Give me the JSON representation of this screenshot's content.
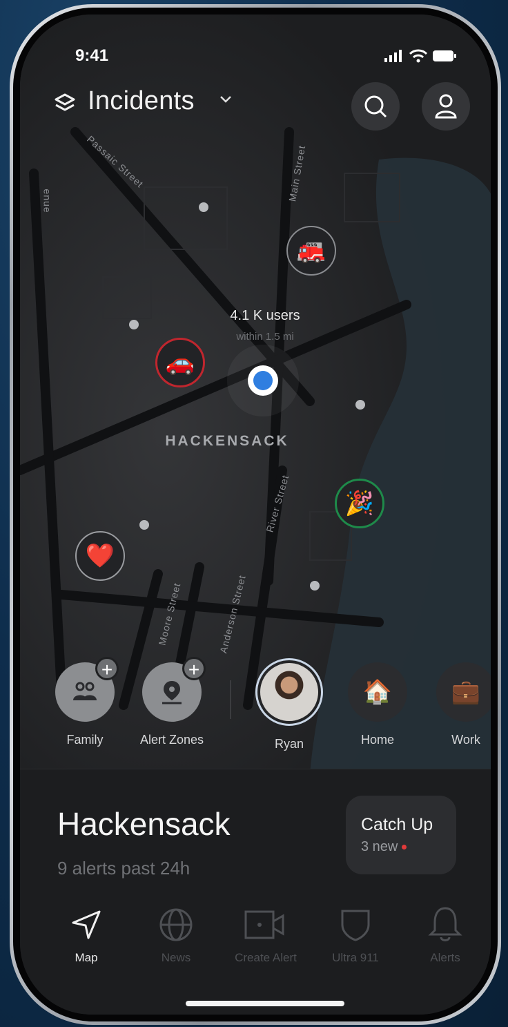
{
  "status": {
    "time": "9:41"
  },
  "header": {
    "title": "Incidents",
    "layers_icon": "layers-icon",
    "search_icon": "search-icon",
    "profile_icon": "person-icon"
  },
  "map": {
    "streets": [
      "Passaic Street",
      "Main Street",
      "River Street",
      "Moore Street",
      "Anderson Street",
      "enue"
    ],
    "users_count": "4.1 K users",
    "users_radius": "within 1.5 mi",
    "city_label": "HACKENSACK",
    "pins": [
      {
        "name": "fire-truck",
        "icon": "🚒",
        "ring": "#8a8c90"
      },
      {
        "name": "car-crash",
        "icon": "🚗",
        "ring": "#c0262e"
      },
      {
        "name": "party",
        "icon": "🎉",
        "ring": "#1e8a4a"
      },
      {
        "name": "medical",
        "icon": "❤️",
        "ring": "#9a9ca0"
      }
    ]
  },
  "shortcuts": [
    {
      "label": "Family",
      "icon": "family-icon"
    },
    {
      "label": "Alert Zones",
      "icon": "location-pin-icon"
    },
    {
      "label": "Ryan",
      "icon": "avatar"
    },
    {
      "label": "Home",
      "icon": "🏠"
    },
    {
      "label": "Work",
      "icon": "💼"
    }
  ],
  "sheet": {
    "city": "Hackensack",
    "summary": "9 alerts past 24h",
    "catchup_title": "Catch Up",
    "catchup_sub": "3 new"
  },
  "tabs": [
    {
      "label": "Map",
      "active": true
    },
    {
      "label": "News",
      "active": false
    },
    {
      "label": "Create Alert",
      "active": false
    },
    {
      "label": "Ultra 911",
      "active": false
    },
    {
      "label": "Alerts",
      "active": false
    }
  ]
}
